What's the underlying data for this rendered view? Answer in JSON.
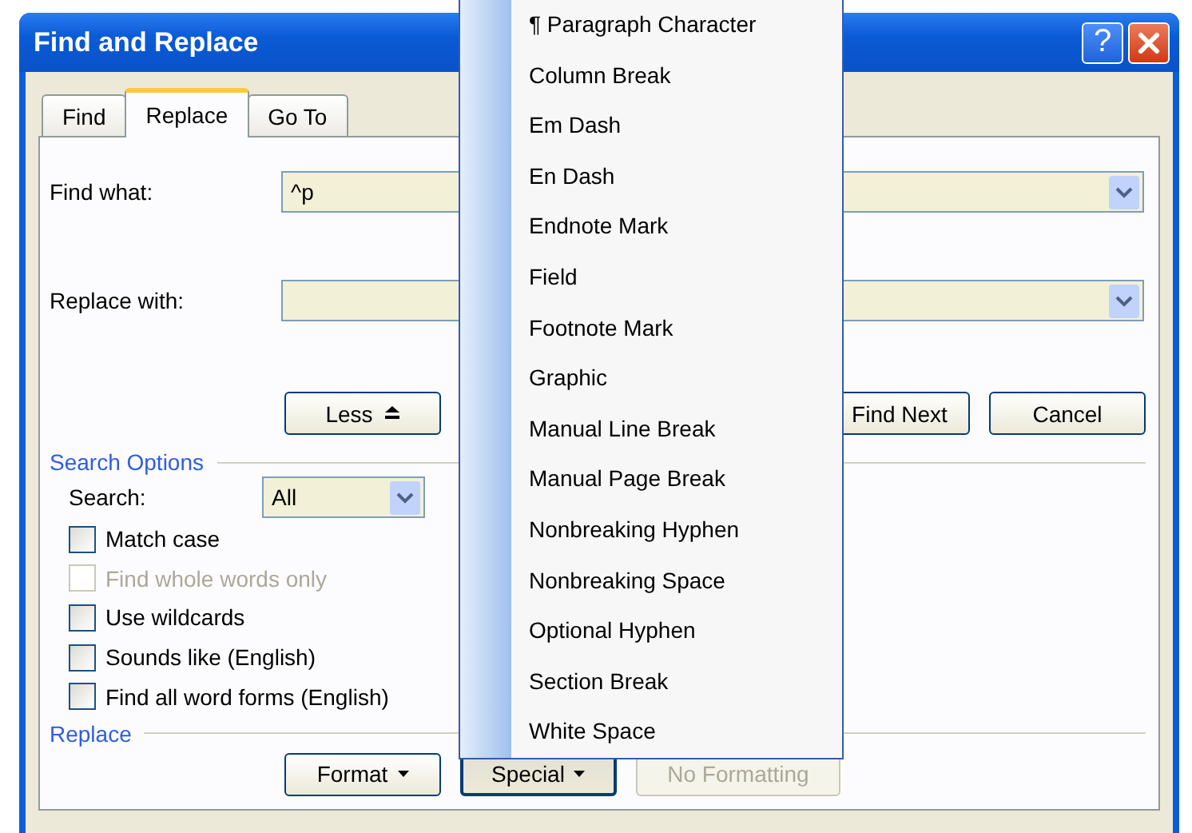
{
  "window": {
    "title": "Find and Replace",
    "help_label": "?"
  },
  "tabs": [
    {
      "label": "Find",
      "selected": false
    },
    {
      "label": "Replace",
      "selected": true
    },
    {
      "label": "Go To",
      "selected": false
    }
  ],
  "fields": [
    {
      "label": "Find what:",
      "value": "^p"
    },
    {
      "label": "Replace with:"
    }
  ],
  "less_button": {
    "label": "Less"
  },
  "action_buttons": [
    {
      "label": "Find Next"
    },
    {
      "label": "Cancel"
    }
  ],
  "search_options": {
    "heading": "Search Options",
    "search_label": "Search:",
    "search_value": "All",
    "checkboxes": [
      {
        "label": "Match case",
        "checked": false,
        "disabled": false
      },
      {
        "label": "Find whole words only",
        "checked": false,
        "disabled": true
      },
      {
        "label": "Use wildcards",
        "checked": false,
        "disabled": false
      },
      {
        "label": "Sounds like (English)",
        "checked": false,
        "disabled": false
      },
      {
        "label": "Find all word forms (English)",
        "checked": false,
        "disabled": false
      }
    ]
  },
  "replace_section": {
    "heading": "Replace",
    "buttons": [
      {
        "label": "Format",
        "kind": "dropdown",
        "disabled": false,
        "expanded": false
      },
      {
        "label": "Special",
        "kind": "dropdown",
        "disabled": false,
        "expanded": true
      },
      {
        "label": "No Formatting",
        "kind": "plain",
        "disabled": true,
        "expanded": false
      }
    ]
  },
  "special_menu": {
    "items": [
      "¶ Paragraph Character",
      "Column Break",
      "Em Dash",
      "En Dash",
      "Endnote Mark",
      "Field",
      "Footnote Mark",
      "Graphic",
      "Manual Line Break",
      "Manual Page Break",
      "Nonbreaking Hyphen",
      "Nonbreaking Space",
      "Optional Hyphen",
      "Section Break",
      "White Space"
    ]
  }
}
